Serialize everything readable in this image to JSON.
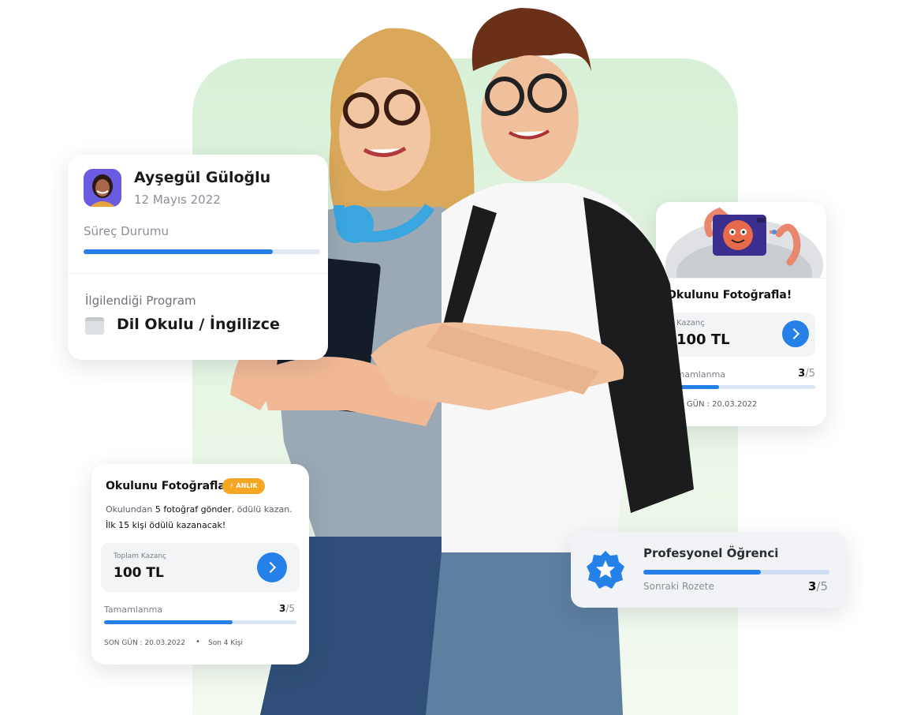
{
  "colors": {
    "accent": "#2580e8",
    "badge": "#f5a623",
    "panel_bg": "#d8f0d8"
  },
  "profile_card": {
    "name": "Ayşegül Güloğlu",
    "date": "12 Mayıs 2022",
    "status_label": "Süreç Durumu",
    "status_progress": 0.8,
    "program_label": "İlgilendiği Program",
    "program_value": "Dil Okulu / İngilizce",
    "program_icon": "browser-window-icon"
  },
  "task_small": {
    "title": "Okulunu Fotoğrafla!",
    "earnings_label": "Kazanç",
    "earnings_value": "100 TL",
    "completion_label": "Tamamlanma",
    "completion_done": "3",
    "completion_total": "5",
    "completion_progress": 0.35,
    "deadline": "SON GÜN : 20.03.2022",
    "button_icon": "chevron-right-icon"
  },
  "task_big": {
    "title": "Okulunu Fotoğrafla!",
    "badge": "ANLIK",
    "badge_icon": "lightning-icon",
    "desc_1": "Okulundan",
    "desc_2": "5 fotoğraf gönder",
    "desc_3": ", ödülü kazan.",
    "desc_4": "İlk 15 kişi ödülü kazanacak!",
    "earnings_label": "Toplam Kazanç",
    "earnings_value": "100 TL",
    "completion_label": "Tamamlanma",
    "completion_done": "3",
    "completion_total": "5",
    "completion_progress": 0.67,
    "deadline": "SON GÜN : 20.03.2022",
    "separator": "•",
    "people": "Son 4 Kişi",
    "button_icon": "chevron-right-icon"
  },
  "badge_card": {
    "title": "Profesyonel Öğrenci",
    "next_label": "Sonraki Rozete",
    "progress_done": "3",
    "progress_total": "5",
    "progress": 0.63,
    "icon": "star-badge-icon"
  }
}
